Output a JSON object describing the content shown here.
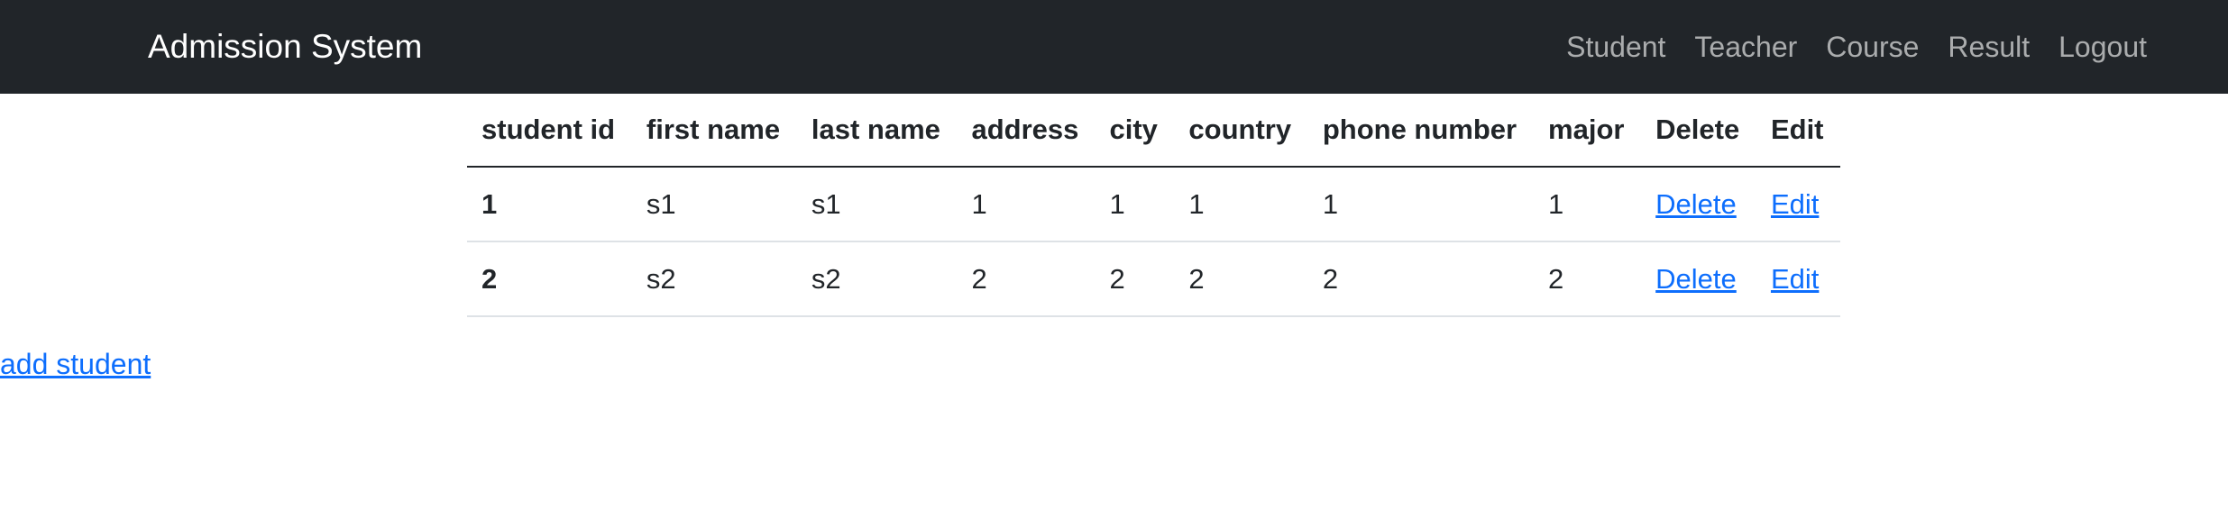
{
  "navbar": {
    "brand": "Admission System",
    "links": [
      "Student",
      "Teacher",
      "Course",
      "Result",
      "Logout"
    ]
  },
  "table": {
    "headers": [
      "student id",
      "first name",
      "last name",
      "address",
      "city",
      "country",
      "phone number",
      "major",
      "Delete",
      "Edit"
    ],
    "rows": [
      {
        "id": "1",
        "first": "s1",
        "last": "s1",
        "address": "1",
        "city": "1",
        "country": "1",
        "phone": "1",
        "major": "1",
        "delete": "Delete",
        "edit": "Edit"
      },
      {
        "id": "2",
        "first": "s2",
        "last": "s2",
        "address": "2",
        "city": "2",
        "country": "2",
        "phone": "2",
        "major": "2",
        "delete": "Delete",
        "edit": "Edit"
      }
    ]
  },
  "add_student_label": "add student",
  "colors": {
    "navbar_bg": "#212529",
    "link": "#0d6efd"
  }
}
